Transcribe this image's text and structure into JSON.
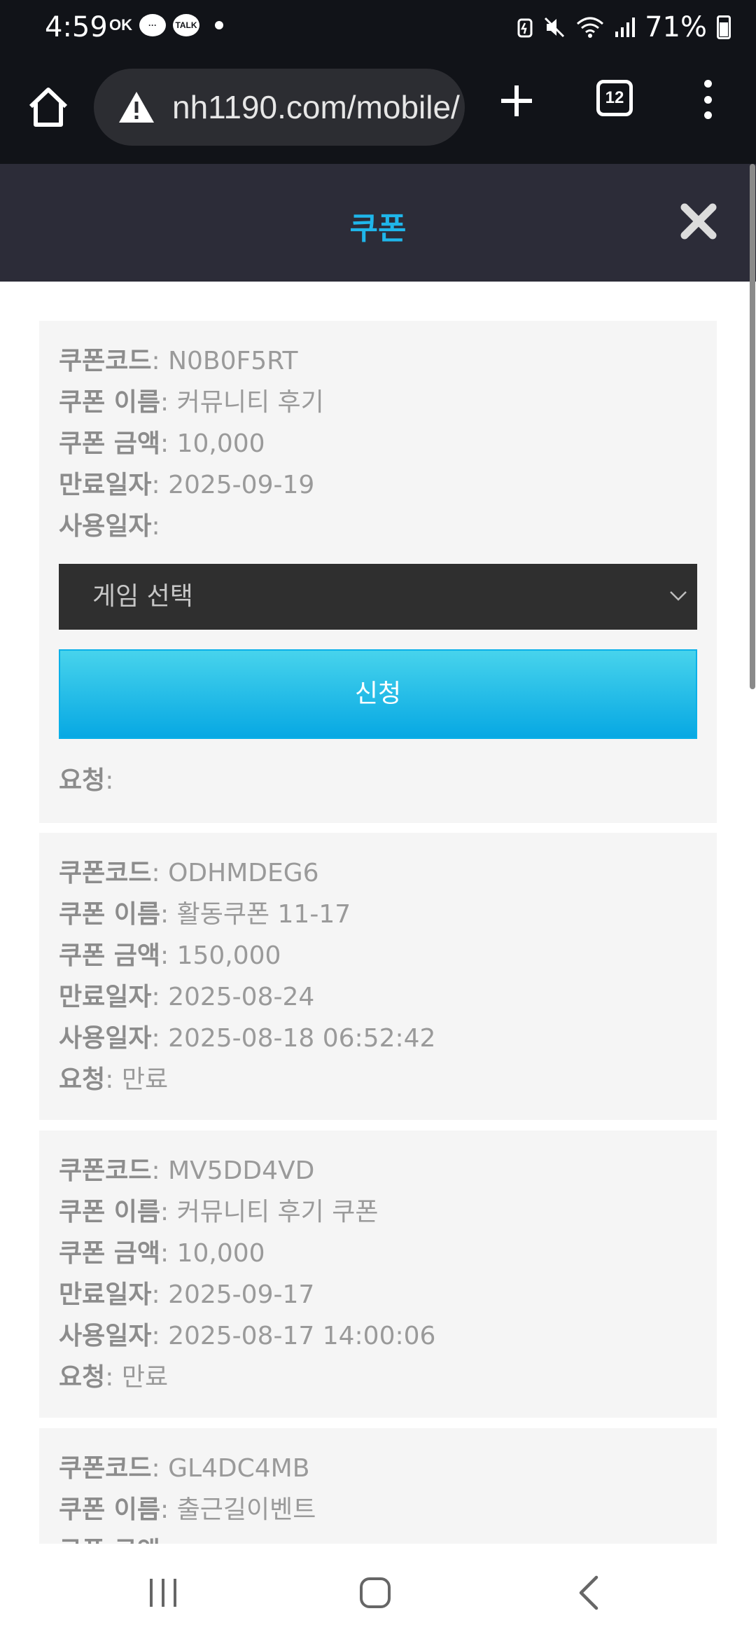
{
  "status_bar": {
    "time": "4:59",
    "ok_label": "OK",
    "talk_label": "TALK",
    "battery": "71%"
  },
  "browser": {
    "url": "nh1190.com/mobile/",
    "tab_count": "12"
  },
  "modal": {
    "title": "쿠폰"
  },
  "labels": {
    "code": "쿠폰코드",
    "name": "쿠폰 이름",
    "amount": "쿠폰 금액",
    "expiry": "만료일자",
    "used": "사용일자",
    "request": "요청"
  },
  "coupons": [
    {
      "code": "N0B0F5RT",
      "name": "커뮤니티 후기",
      "amount": "10,000",
      "expiry": "2025-09-19",
      "used": "",
      "request": "",
      "game_select_placeholder": "게임 선택",
      "apply_label": "신청"
    },
    {
      "code": "ODHMDEG6",
      "name": "활동쿠폰 11-17",
      "amount": "150,000",
      "expiry": "2025-08-24",
      "used": "2025-08-18 06:52:42",
      "request": "만료"
    },
    {
      "code": "MV5DD4VD",
      "name": "커뮤니티 후기 쿠폰",
      "amount": "10,000",
      "expiry": "2025-09-17",
      "used": "2025-08-17 14:00:06",
      "request": "만료"
    },
    {
      "code": "GL4DC4MB",
      "name": "출근길이벤트"
    }
  ],
  "colors": {
    "status_bg": "#111318",
    "modal_header_bg": "#2c2c38",
    "title_accent": "#1fb6ea",
    "card_bg": "#f5f5f5",
    "select_bg": "#2f2f2f",
    "button_top": "#47d3ec",
    "button_bottom": "#07a8e3"
  }
}
